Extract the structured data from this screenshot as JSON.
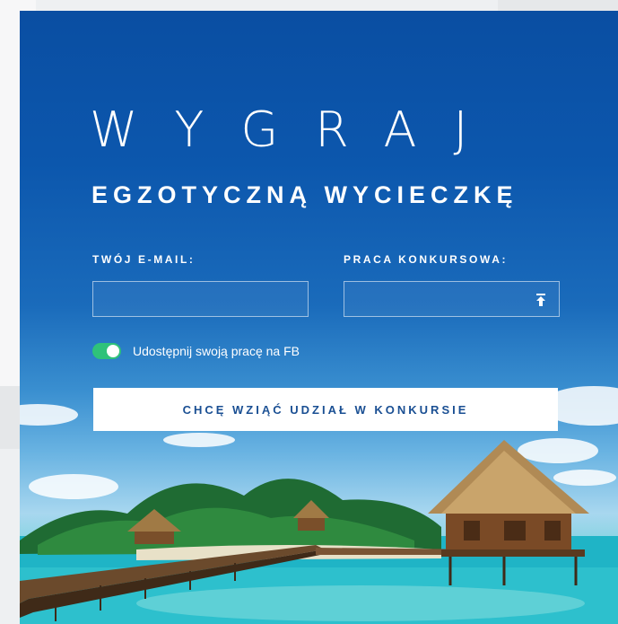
{
  "hero": {
    "title": "WYGRAJ",
    "subtitle": "EGZOTYCZNĄ WYCIECZKĘ"
  },
  "form": {
    "email_label": "TWÓJ E-MAIL:",
    "email_value": "",
    "work_label": "PRACA KONKURSOWA:",
    "work_value": "",
    "upload_icon": "upload-icon",
    "share_toggle_on": true,
    "share_label": "Udostępnij swoją pracę na FB",
    "submit_label": "CHCĘ WZIĄĆ UDZIAŁ W KONKURSIE"
  },
  "colors": {
    "sky": "#0c57ad",
    "toggle": "#2fc27a",
    "button_text": "#1a4f93",
    "water": "#22b5c7"
  }
}
